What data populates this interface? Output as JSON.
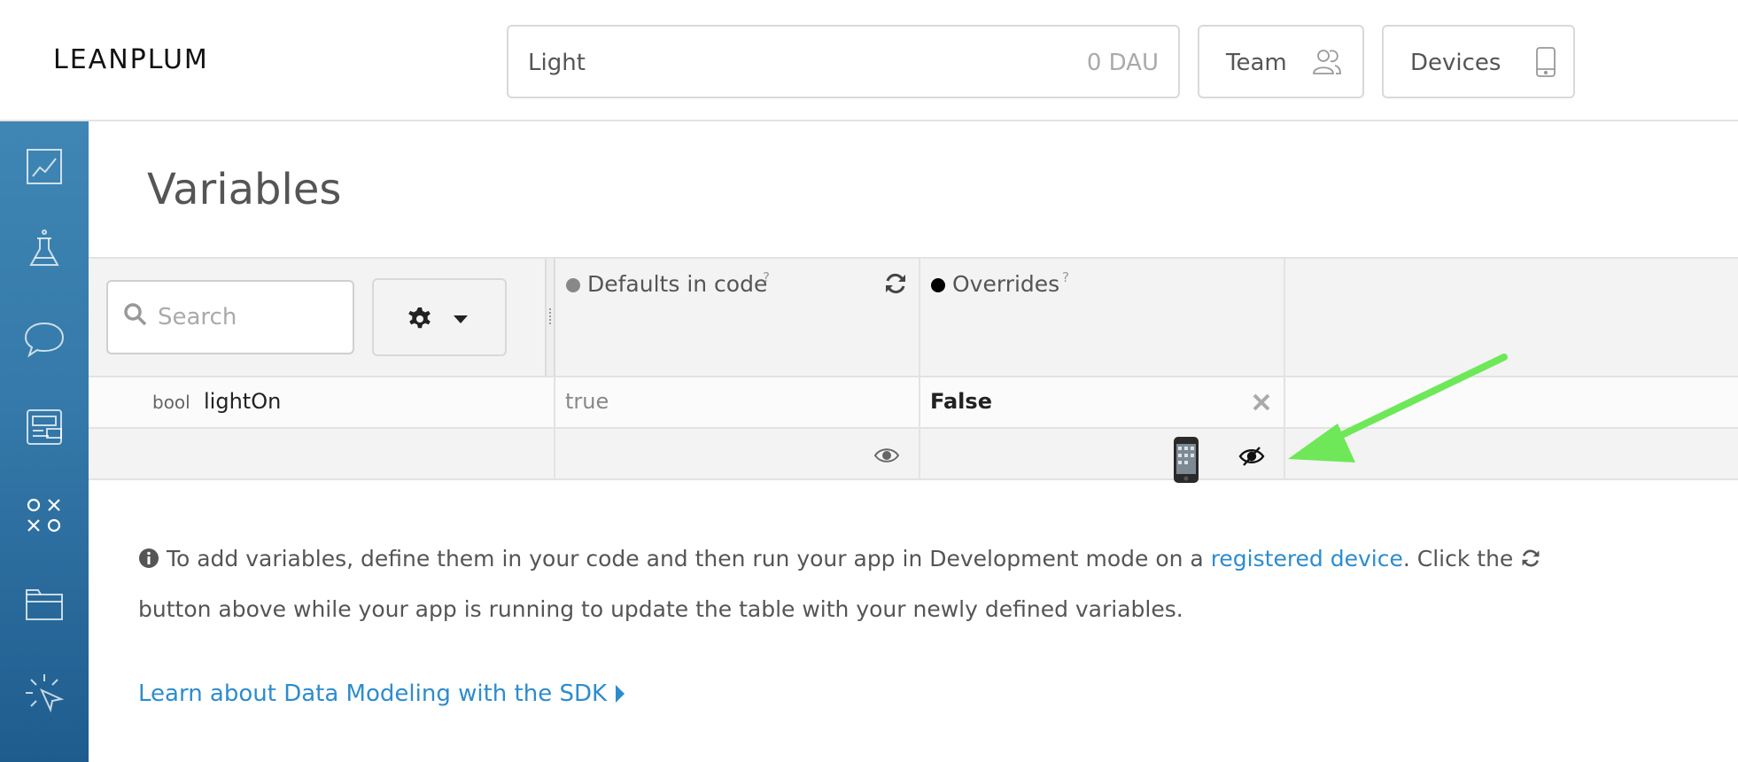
{
  "header": {
    "logo": "LEANPLUM",
    "app_name": "Light",
    "dau": "0 DAU",
    "team_label": "Team",
    "devices_label": "Devices"
  },
  "sidebar": {
    "items": [
      "analytics-icon",
      "ab-test-icon",
      "messaging-icon",
      "dashboard-icon",
      "variables-icon",
      "files-icon",
      "interface-editor-icon"
    ]
  },
  "page": {
    "title": "Variables"
  },
  "table": {
    "search_placeholder": "Search",
    "columns": {
      "defaults": "Defaults in code",
      "overrides": "Overrides",
      "help": "?"
    },
    "rows": [
      {
        "type": "bool",
        "name": "lightOn",
        "default": "true",
        "override": "False"
      }
    ]
  },
  "info": {
    "text1": " To add variables, define them in your code and then run your app in Development mode on a ",
    "link": "registered device",
    "text2": ". Click the ",
    "text3": " button above while your app is running to update the table with your newly defined variables.",
    "learn_link": "Learn about Data Modeling with the SDK"
  },
  "colors": {
    "link": "#2d8ccd",
    "sidebar_top": "#3f86b4",
    "sidebar_bottom": "#1f5c8e",
    "arrow": "#6ee859"
  }
}
